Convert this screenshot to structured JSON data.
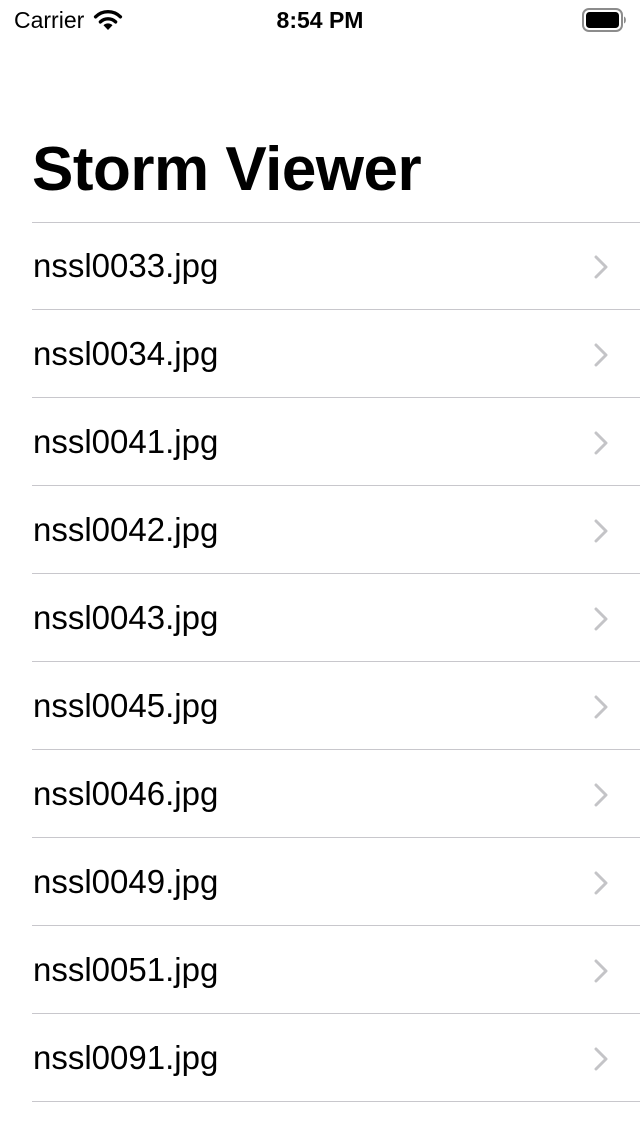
{
  "status_bar": {
    "carrier": "Carrier",
    "time": "8:54 PM",
    "icons": [
      "wifi-icon",
      "battery-icon"
    ]
  },
  "nav": {
    "title": "Storm Viewer"
  },
  "list": {
    "accessory_icon": "chevron-right-icon",
    "items": [
      {
        "label": "nssl0033.jpg"
      },
      {
        "label": "nssl0034.jpg"
      },
      {
        "label": "nssl0041.jpg"
      },
      {
        "label": "nssl0042.jpg"
      },
      {
        "label": "nssl0043.jpg"
      },
      {
        "label": "nssl0045.jpg"
      },
      {
        "label": "nssl0046.jpg"
      },
      {
        "label": "nssl0049.jpg"
      },
      {
        "label": "nssl0051.jpg"
      },
      {
        "label": "nssl0091.jpg"
      }
    ]
  },
  "colors": {
    "background": "#ffffff",
    "text": "#000000",
    "separator": "#c8c7cc",
    "chevron": "#c4c4c7"
  }
}
